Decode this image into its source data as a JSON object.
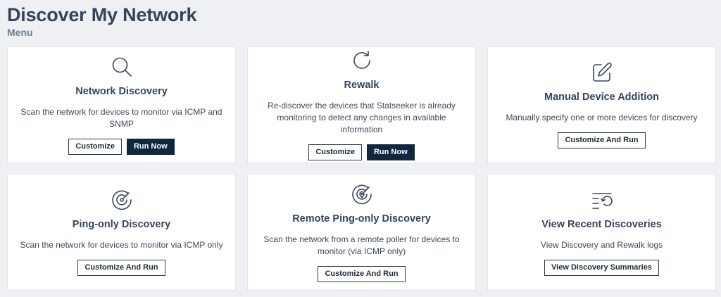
{
  "page": {
    "title": "Discover My Network",
    "subtitle": "Menu"
  },
  "cards": [
    {
      "icon": "search-icon",
      "title": "Network Discovery",
      "description": "Scan the network for devices to monitor via ICMP and SNMP",
      "buttons": [
        {
          "label": "Customize",
          "style": "outline"
        },
        {
          "label": "Run Now",
          "style": "primary"
        }
      ]
    },
    {
      "icon": "refresh-icon",
      "title": "Rewalk",
      "description": "Re-discover the devices that Statseeker is already monitoring to detect any changes in available information",
      "buttons": [
        {
          "label": "Customize",
          "style": "outline"
        },
        {
          "label": "Run Now",
          "style": "primary"
        }
      ]
    },
    {
      "icon": "edit-icon",
      "title": "Manual Device Addition",
      "description": "Manually specify one or more devices for discovery",
      "buttons": [
        {
          "label": "Customize And Run",
          "style": "outline"
        }
      ]
    },
    {
      "icon": "radar-icon",
      "title": "Ping-only Discovery",
      "description": "Scan the network for devices to monitor via ICMP only",
      "buttons": [
        {
          "label": "Customize And Run",
          "style": "outline"
        }
      ]
    },
    {
      "icon": "remote-radar-icon",
      "title": "Remote Ping-only Discovery",
      "description": "Scan the network from a remote poller for devices to monitor (via ICMP only)",
      "buttons": [
        {
          "label": "Customize And Run",
          "style": "outline"
        }
      ]
    },
    {
      "icon": "history-list-icon",
      "title": "View Recent Discoveries",
      "description": "View Discovery and Rewalk logs",
      "buttons": [
        {
          "label": "View Discovery Summaries",
          "style": "outline"
        }
      ]
    }
  ],
  "colors": {
    "background": "#eef0f3",
    "card": "#ffffff",
    "primary_button": "#0f2740",
    "title": "#34455b"
  }
}
